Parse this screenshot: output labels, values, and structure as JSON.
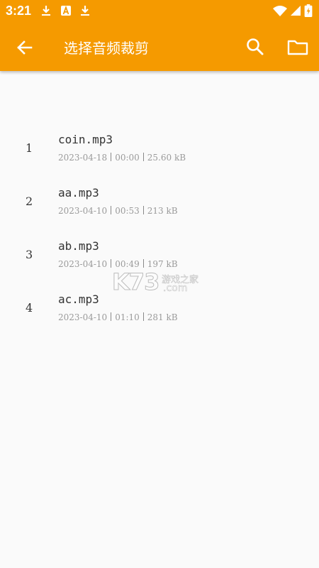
{
  "status_bar": {
    "time": "3:21",
    "left_icons": [
      "download-icon",
      "android-a-icon",
      "download-icon"
    ],
    "right_icons": [
      "wifi-icon",
      "signal-icon",
      "battery-charging-icon"
    ]
  },
  "app_bar": {
    "title": "选择音频裁剪",
    "color": "#f59a00",
    "back_icon": "arrow-back-icon",
    "search_icon": "search-icon",
    "folder_icon": "folder-icon"
  },
  "files": [
    {
      "index": "1",
      "name": "coin.mp3",
      "date": "2023-04-18",
      "duration": "00:00",
      "size": "25.60 kB"
    },
    {
      "index": "2",
      "name": "aa.mp3",
      "date": "2023-04-10",
      "duration": "00:53",
      "size": "213 kB"
    },
    {
      "index": "3",
      "name": "ab.mp3",
      "date": "2023-04-10",
      "duration": "00:49",
      "size": "197 kB"
    },
    {
      "index": "4",
      "name": "ac.mp3",
      "date": "2023-04-10",
      "duration": "01:10",
      "size": "281 kB"
    }
  ],
  "watermark": {
    "logo": "K73",
    "site_name": "游戏之家",
    "domain": ".com"
  }
}
